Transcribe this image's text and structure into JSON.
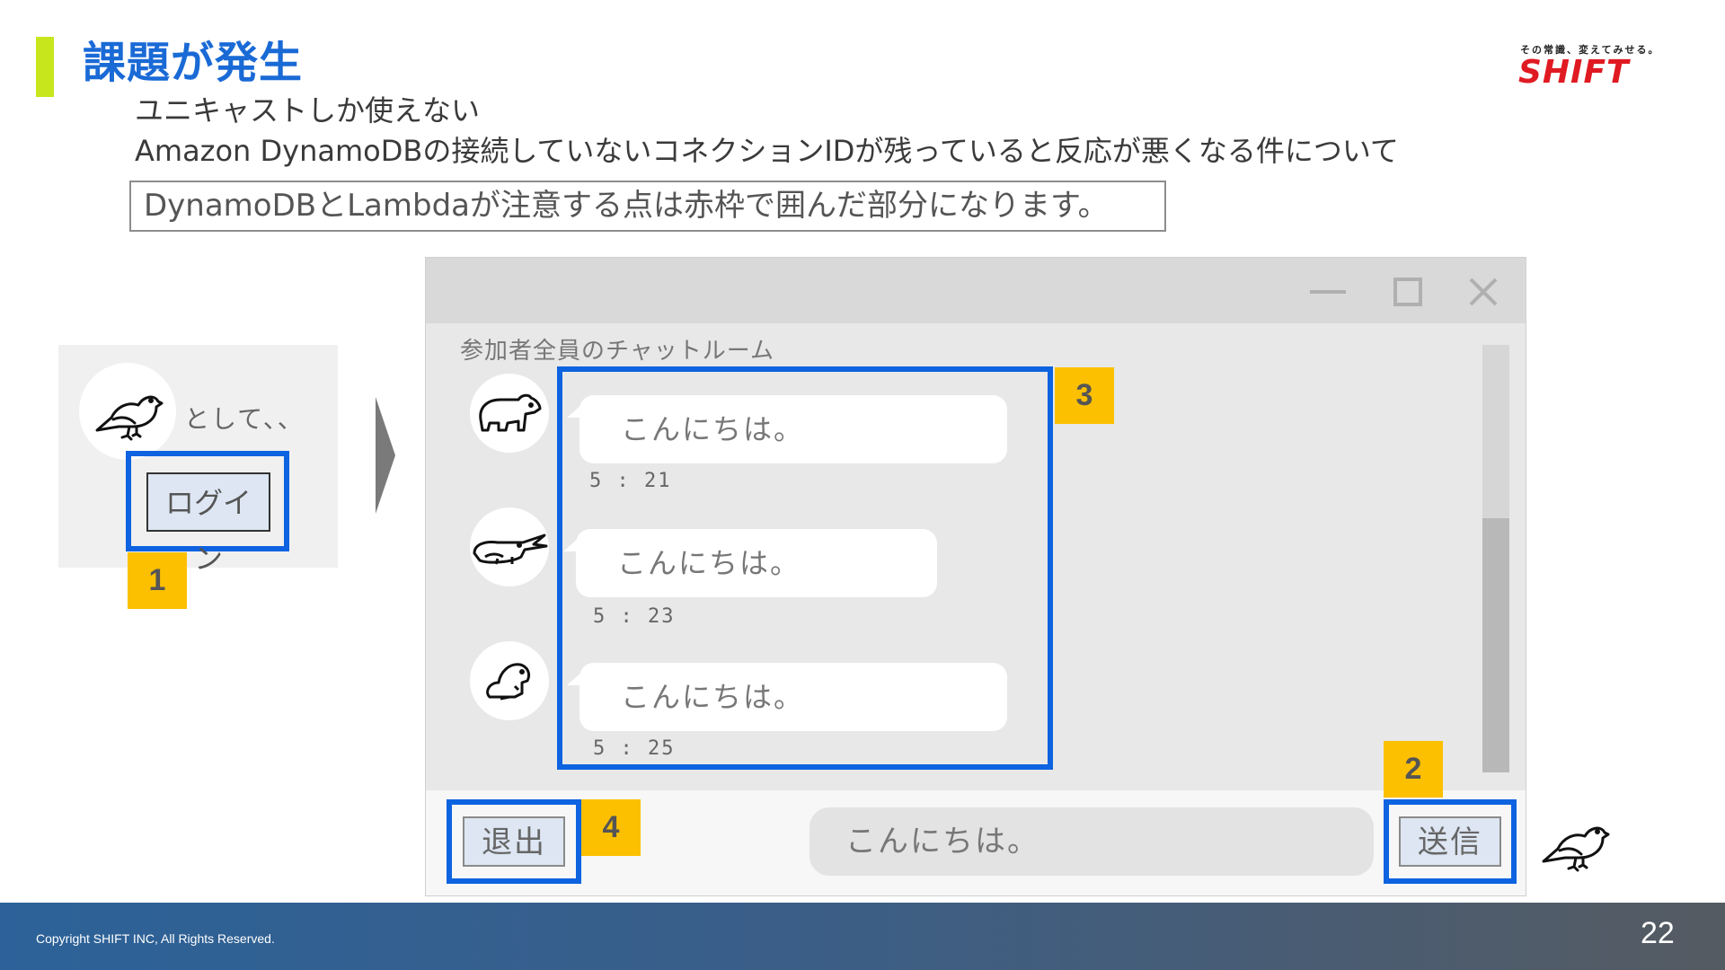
{
  "header": {
    "title": "課題が発生",
    "subtitle_line1": "ユニキャストしか使えない",
    "subtitle_line2": "Amazon DynamoDBの接続していないコネクションIDが残っていると反応が悪くなる件について",
    "note": "DynamoDBとLambdaが注意する点は赤枠で囲んだ部分になります。"
  },
  "logo": {
    "tagline": "その常識、変えてみせる。",
    "brand": "SHIFT",
    "brand_color": "#e01a22"
  },
  "login_panel": {
    "avatar_icon": "bird-icon",
    "as_text": "として、、",
    "login_button": "ログイン",
    "marker": "1"
  },
  "chat_window": {
    "window_controls": [
      "minimize-icon",
      "maximize-icon",
      "close-icon"
    ],
    "room_label": "参加者全員のチャットルーム",
    "messages": [
      {
        "avatar_icon": "bear-icon",
        "text": "こんにちは。",
        "time": "5 : 21"
      },
      {
        "avatar_icon": "crocodile-icon",
        "text": "こんにちは。",
        "time": "5 : 23"
      },
      {
        "avatar_icon": "beaver-icon",
        "text": "こんにちは。",
        "time": "5 : 25"
      }
    ],
    "messages_marker": "3",
    "input_value": "こんにちは。",
    "send_button": "送信",
    "send_marker": "2",
    "exit_button": "退出",
    "exit_marker": "4",
    "self_avatar_icon": "bird-icon"
  },
  "colors": {
    "highlight": "#0d63e0",
    "marker": "#fcc000",
    "title": "#1a6ad6",
    "accent_bar": "#c8e61c"
  },
  "footer": {
    "copyright": "Copyright SHIFT INC, All Rights Reserved.",
    "page_number": "22"
  }
}
